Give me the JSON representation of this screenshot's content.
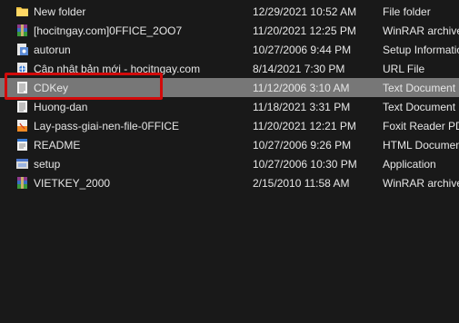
{
  "files": [
    {
      "name": "New folder",
      "modified": "12/29/2021 10:52 AM",
      "type": "File folder",
      "icon": "folder-icon"
    },
    {
      "name": "[hocitngay.com]0FFICE_2OO7",
      "modified": "11/20/2021 12:25 PM",
      "type": "WinRAR archive",
      "icon": "winrar-archive-icon"
    },
    {
      "name": "autorun",
      "modified": "10/27/2006 9:44 PM",
      "type": "Setup Information",
      "icon": "setup-info-icon"
    },
    {
      "name": "Cập nhật bản mới - hocitngay.com",
      "modified": "8/14/2021 7:30 PM",
      "type": "URL File",
      "icon": "url-file-icon"
    },
    {
      "name": "CDKey",
      "modified": "11/12/2006 3:10 AM",
      "type": "Text Document",
      "icon": "text-document-icon"
    },
    {
      "name": "Huong-dan",
      "modified": "11/18/2021 3:31 PM",
      "type": "Text Document",
      "icon": "text-document-icon"
    },
    {
      "name": "Lay-pass-giai-nen-file-0FFICE",
      "modified": "11/20/2021 12:21 PM",
      "type": "Foxit Reader PDF",
      "icon": "pdf-icon"
    },
    {
      "name": "README",
      "modified": "10/27/2006 9:26 PM",
      "type": "HTML Document",
      "icon": "html-document-icon"
    },
    {
      "name": "setup",
      "modified": "10/27/2006 10:30 PM",
      "type": "Application",
      "icon": "application-icon"
    },
    {
      "name": "VIETKEY_2000",
      "modified": "2/15/2010 11:58 AM",
      "type": "WinRAR archive",
      "icon": "winrar-archive-icon"
    }
  ],
  "selected_index": 4,
  "colors": {
    "background": "#191919",
    "selected_row": "#777777",
    "highlight_box": "#d20a0a",
    "text": "#e6e6e6"
  }
}
